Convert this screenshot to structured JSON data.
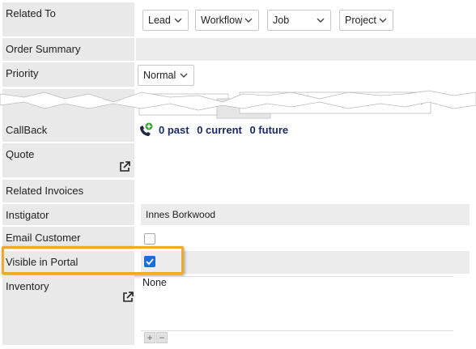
{
  "rows": {
    "related_to": "Related To",
    "order_summary": "Order Summary",
    "priority": "Priority",
    "callback": "CallBack",
    "quote": "Quote",
    "related_invoices": "Related Invoices",
    "instigator": "Instigator",
    "email_customer": "Email Customer",
    "visible_in_portal": "Visible in Portal",
    "inventory": "Inventory"
  },
  "related_selects": {
    "lead": "Lead",
    "workflow": "Workflow",
    "job": "Job",
    "project": "Project"
  },
  "priority_value": "Normal",
  "callback": {
    "past": "0 past",
    "current": "0 current",
    "future": "0 future"
  },
  "instigator_value": "Innes Borkwood",
  "email_customer_checked": false,
  "visible_in_portal_checked": true,
  "inventory_value": "None",
  "inventory_controls": {
    "add": "+",
    "remove": "−"
  },
  "colors": {
    "label_bg": "#e9e9e9",
    "highlight": "#f0a92a",
    "checkbox_on": "#1a6fd6",
    "callback_text": "#1b2a66",
    "phone_green": "#3aa63a"
  },
  "icons": [
    "phone-icon",
    "external-link-icon",
    "chevron-down-icon",
    "checkmark-icon"
  ]
}
